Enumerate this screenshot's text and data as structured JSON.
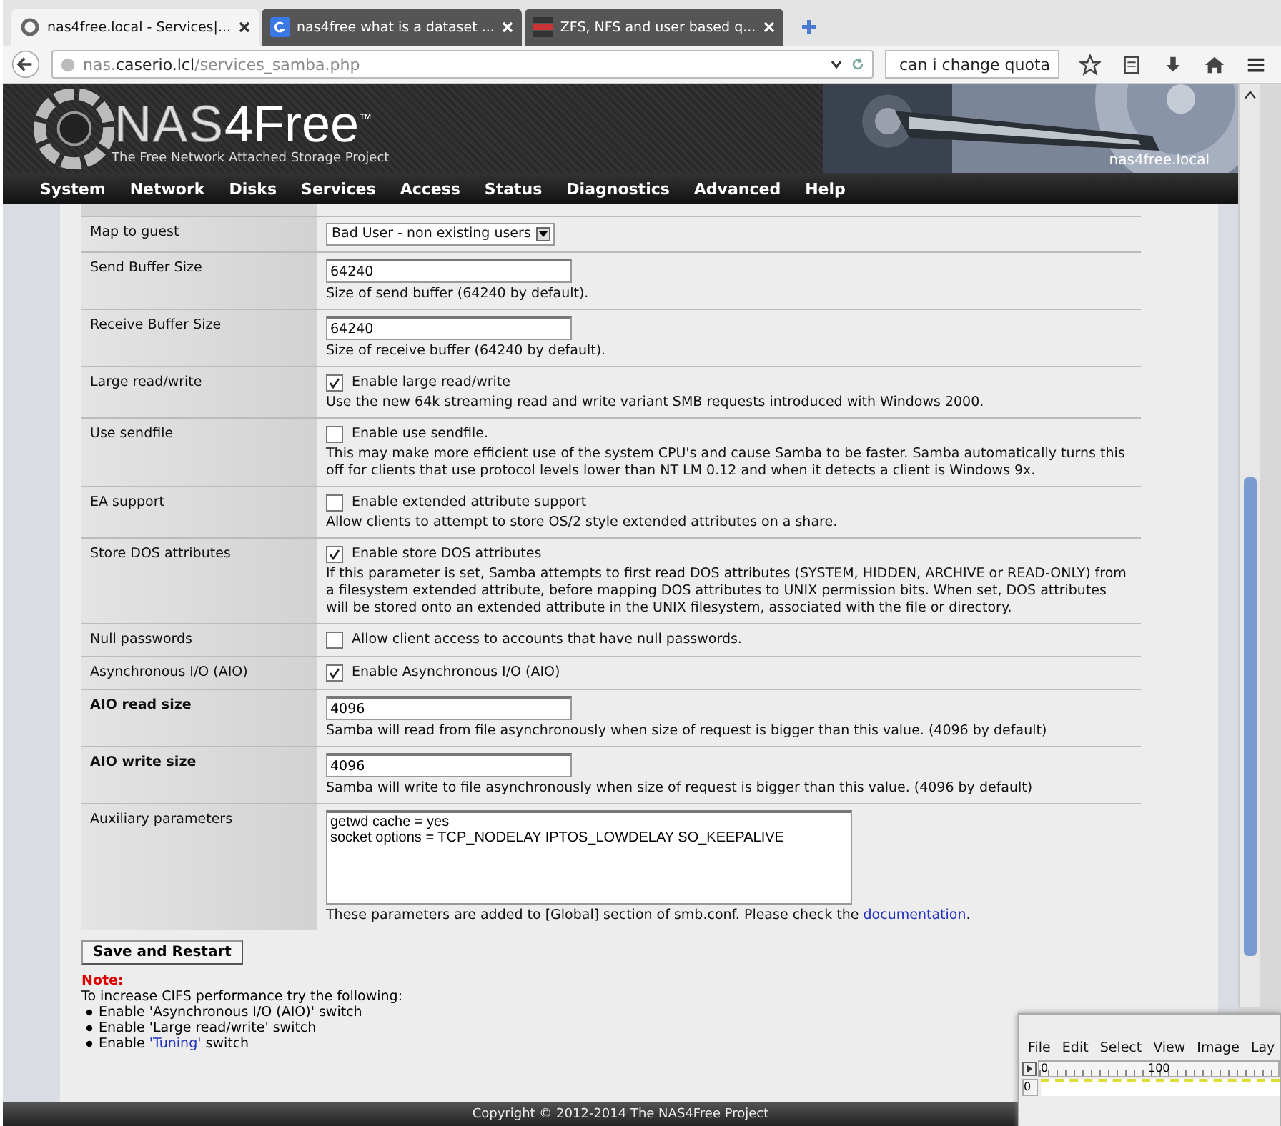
{
  "browser": {
    "tabs": [
      {
        "title": "nas4free.local - Services|...",
        "selected": true
      },
      {
        "title": "nas4free what is a dataset ...",
        "selected": false
      },
      {
        "title": "ZFS, NFS and user based q...",
        "selected": false
      }
    ],
    "url": {
      "prefix": "nas.",
      "domain": "caserio.lcl",
      "path": "/services_samba.php"
    },
    "search": {
      "value": "can i change quota"
    }
  },
  "header": {
    "logo_main": "NAS",
    "logo_accent": "4Free",
    "logo_mark": "™",
    "tagline": "The Free Network Attached Storage Project",
    "hostname": "nas4free.local"
  },
  "menu": [
    "System",
    "Network",
    "Disks",
    "Services",
    "Access",
    "Status",
    "Diagnostics",
    "Advanced",
    "Help"
  ],
  "settings": [
    {
      "kind": "select",
      "label": "Map to guest",
      "bold": false,
      "value": "Bad User - non existing users"
    },
    {
      "kind": "text",
      "label": "Send Buffer Size",
      "bold": false,
      "value": "64240",
      "help": "Size of send buffer (64240 by default)."
    },
    {
      "kind": "text",
      "label": "Receive Buffer Size",
      "bold": false,
      "value": "64240",
      "help": "Size of receive buffer (64240 by default)."
    },
    {
      "kind": "checkbox",
      "label": "Large read/write",
      "bold": false,
      "checked": true,
      "option": "Enable large read/write",
      "help": "Use the new 64k streaming read and write variant SMB requests introduced with Windows 2000."
    },
    {
      "kind": "checkbox",
      "label": "Use sendfile",
      "bold": false,
      "checked": false,
      "option": "Enable use sendfile.",
      "help": "This may make more efficient use of the system CPU's and cause Samba to be faster. Samba automatically turns this off for clients that use protocol levels lower than NT LM 0.12 and when it detects a client is Windows 9x."
    },
    {
      "kind": "checkbox",
      "label": "EA support",
      "bold": false,
      "checked": false,
      "option": "Enable extended attribute support",
      "help": "Allow clients to attempt to store OS/2 style extended attributes on a share."
    },
    {
      "kind": "checkbox",
      "label": "Store DOS attributes",
      "bold": false,
      "checked": true,
      "option": "Enable store DOS attributes",
      "help": "If this parameter is set, Samba attempts to first read DOS attributes (SYSTEM, HIDDEN, ARCHIVE or READ-ONLY) from a filesystem extended attribute, before mapping DOS attributes to UNIX permission bits. When set, DOS attributes will be stored onto an extended attribute in the UNIX filesystem, associated with the file or directory."
    },
    {
      "kind": "checkbox",
      "label": "Null passwords",
      "bold": false,
      "checked": false,
      "option": "Allow client access to accounts that have null passwords."
    },
    {
      "kind": "checkbox",
      "label": "Asynchronous I/O (AIO)",
      "bold": false,
      "checked": true,
      "option": "Enable Asynchronous I/O (AIO)"
    },
    {
      "kind": "text",
      "label": "AIO read size",
      "bold": true,
      "value": "4096",
      "help": "Samba will read from file asynchronously when size of request is bigger than this value. (4096 by default)"
    },
    {
      "kind": "text",
      "label": "AIO write size",
      "bold": true,
      "value": "4096",
      "help": "Samba will write to file asynchronously when size of request is bigger than this value. (4096 by default)"
    },
    {
      "kind": "textarea",
      "label": "Auxiliary parameters",
      "bold": false,
      "lines": [
        "getwd cache = yes",
        "socket options = TCP_NODELAY IPTOS_LOWDELAY SO_KEEPALIVE"
      ],
      "help": "These parameters are added to [Global] section of smb.conf. Please check the ",
      "help_link": "documentation",
      "help_end": "."
    }
  ],
  "save_button": "Save and Restart",
  "note": {
    "title": "Note:",
    "intro": "To increase CIFS performance try the following:",
    "items": [
      {
        "text": "Enable 'Asynchronous I/O (AIO)' switch"
      },
      {
        "text": "Enable 'Large read/write' switch"
      },
      {
        "text": "Enable ",
        "link": "'Tuning'",
        "after": " switch"
      }
    ]
  },
  "footer": "Copyright © 2012-2014 The NAS4Free Project",
  "gimp": {
    "menu": [
      "File",
      "Edit",
      "Select",
      "View",
      "Image",
      "Lay"
    ],
    "ruler_marks": [
      "0",
      "100"
    ],
    "side_mark": "0"
  }
}
